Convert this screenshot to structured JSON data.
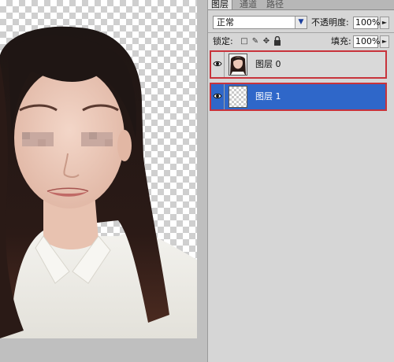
{
  "panel_tabs": [
    "图层",
    "通道",
    "路径"
  ],
  "blend_mode": "正常",
  "opacity_label": "不透明度:",
  "opacity_value": "100%",
  "lock_label": "锁定:",
  "fill_label": "填充:",
  "fill_value": "100%",
  "layers": [
    {
      "name": "图层 0",
      "visible": true,
      "selected": false
    },
    {
      "name": "图层 1",
      "visible": true,
      "selected": true
    }
  ],
  "colors": {
    "selection_blue": "#2f67c9",
    "highlight_red": "#c8333b",
    "panel_gray": "#d6d6d6"
  }
}
